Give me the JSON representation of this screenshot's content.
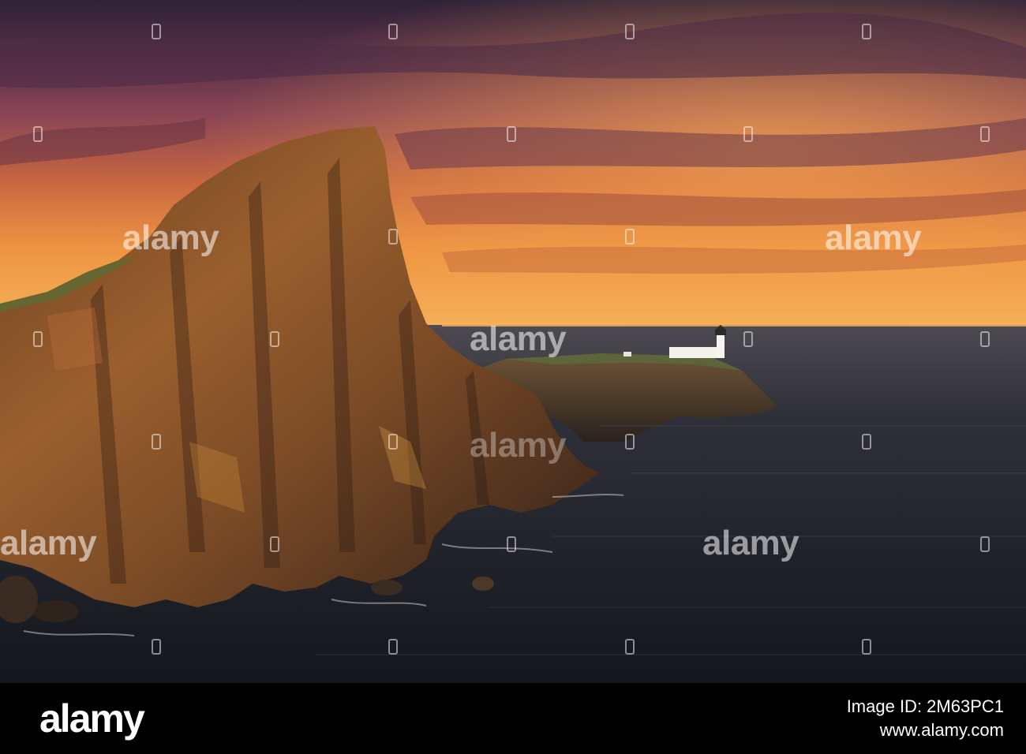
{
  "photo": {
    "description_colors": {
      "sky_top": "#3a2740",
      "sky_mid": "#8a4a55",
      "sky_glow": "#e8893c",
      "horizon": "#f2a24a",
      "sea": "#1f2330",
      "cliff": "#8a5a2e"
    },
    "watermark_text": "alamy"
  },
  "footer": {
    "logo": "alamy",
    "id_line": "Image ID: 2M63PC1",
    "url": "www.alamy.com"
  }
}
